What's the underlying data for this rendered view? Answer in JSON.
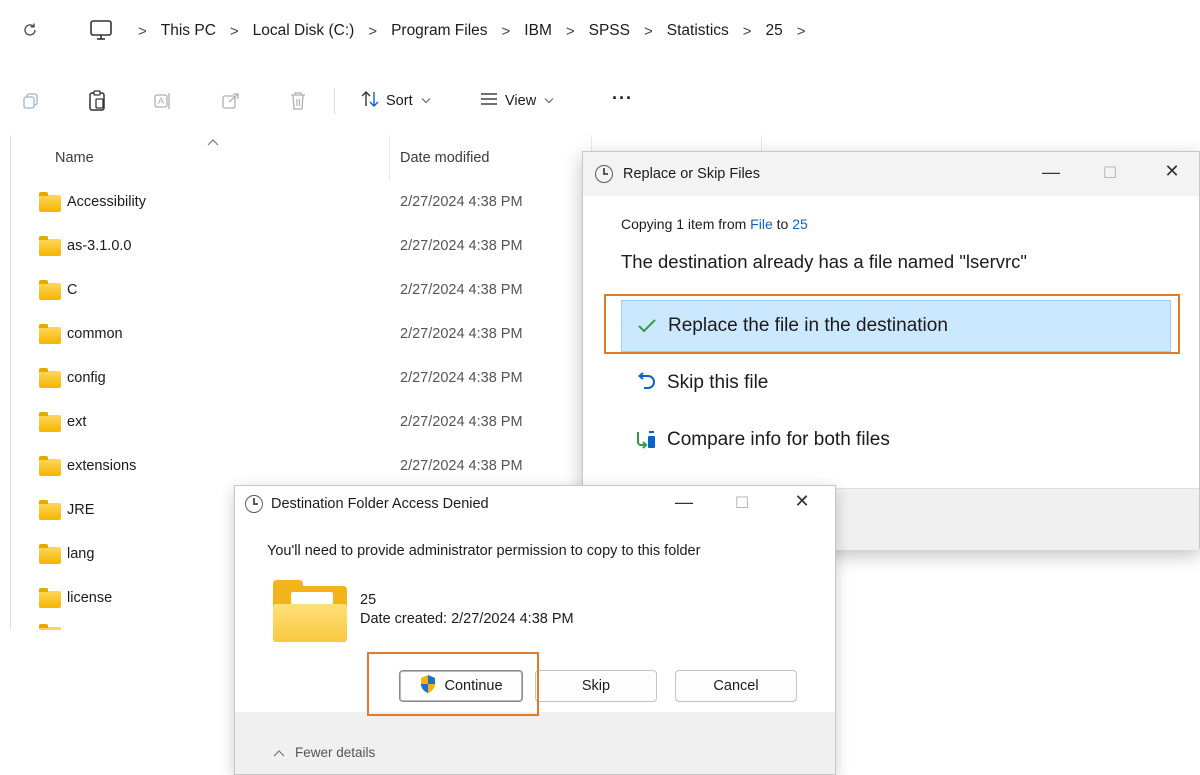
{
  "breadcrumb": {
    "items": [
      "This PC",
      "Local Disk (C:)",
      "Program Files",
      "IBM",
      "SPSS",
      "Statistics",
      "25"
    ],
    "separator": ">"
  },
  "toolbar": {
    "sort_label": "Sort",
    "view_label": "View",
    "more_label": "···"
  },
  "filelist": {
    "columns": {
      "name": "Name",
      "date": "Date modified"
    },
    "rows": [
      {
        "name": "Accessibility",
        "date": "2/27/2024 4:38 PM"
      },
      {
        "name": "as-3.1.0.0",
        "date": "2/27/2024 4:38 PM"
      },
      {
        "name": "C",
        "date": "2/27/2024 4:38 PM"
      },
      {
        "name": "common",
        "date": "2/27/2024 4:38 PM"
      },
      {
        "name": "config",
        "date": "2/27/2024 4:38 PM"
      },
      {
        "name": "ext",
        "date": "2/27/2024 4:38 PM"
      },
      {
        "name": "extensions",
        "date": "2/27/2024 4:38 PM"
      },
      {
        "name": "JRE",
        "date": ""
      },
      {
        "name": "lang",
        "date": ""
      },
      {
        "name": "license",
        "date": ""
      }
    ]
  },
  "replace_dialog": {
    "title": "Replace or Skip Files",
    "copying_prefix": "Copying 1 item from",
    "source": "File",
    "to_word": "to",
    "destination": "25",
    "message": "The destination already has a file named \"lservrc\"",
    "options": {
      "replace": "Replace the file in the destination",
      "skip": "Skip this file",
      "compare": "Compare info for both files"
    }
  },
  "denied_dialog": {
    "title": "Destination Folder Access Denied",
    "message": "You'll need to provide administrator permission to copy to this folder",
    "folder_name": "25",
    "date_created": "Date created: 2/27/2024 4:38 PM",
    "continue_label": "Continue",
    "skip_label": "Skip",
    "cancel_label": "Cancel",
    "fewer_details": "Fewer details"
  },
  "colors": {
    "highlight_orange": "#e07b2c",
    "selection_blue": "#cce8ff",
    "link_blue": "#0a63c9",
    "folder_yellow": "#f4b400"
  }
}
